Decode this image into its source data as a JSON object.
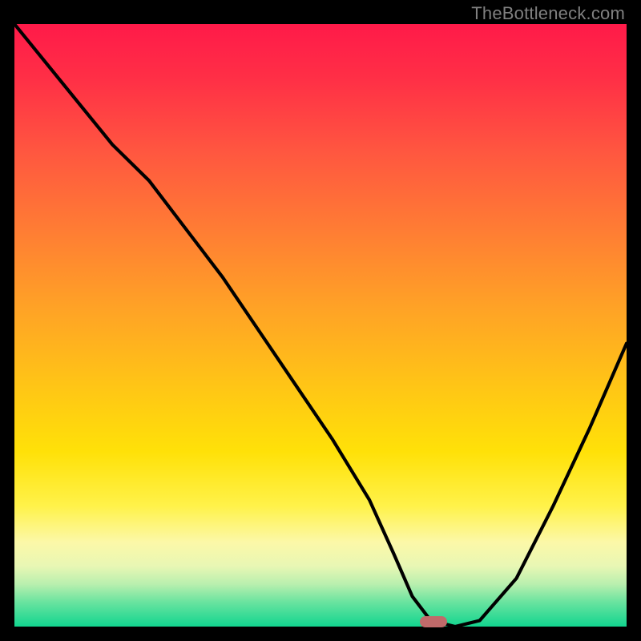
{
  "watermark": "TheBottleneck.com",
  "chart_data": {
    "type": "line",
    "title": "",
    "xlabel": "",
    "ylabel": "",
    "xlim": [
      0,
      100
    ],
    "ylim": [
      0,
      100
    ],
    "grid": false,
    "legend": false,
    "curve": {
      "name": "bottleneck-curve",
      "x": [
        0,
        8,
        16,
        22,
        28,
        34,
        40,
        46,
        52,
        58,
        62,
        65,
        68,
        72,
        76,
        82,
        88,
        94,
        100
      ],
      "y": [
        100,
        90,
        80,
        74,
        66,
        58,
        49,
        40,
        31,
        21,
        12,
        5,
        1,
        0,
        1,
        8,
        20,
        33,
        47
      ]
    },
    "marker": {
      "x": 68.5,
      "y": 0.8,
      "shape": "pill",
      "color": "#c06a6a"
    },
    "background_gradient": {
      "orientation": "vertical",
      "stops": [
        {
          "pos": 0.0,
          "color": "#ff1a49"
        },
        {
          "pos": 0.34,
          "color": "#ff7c34"
        },
        {
          "pos": 0.6,
          "color": "#ffc516"
        },
        {
          "pos": 0.8,
          "color": "#fff24a"
        },
        {
          "pos": 0.93,
          "color": "#b8efae"
        },
        {
          "pos": 1.0,
          "color": "#12d58f"
        }
      ]
    }
  }
}
